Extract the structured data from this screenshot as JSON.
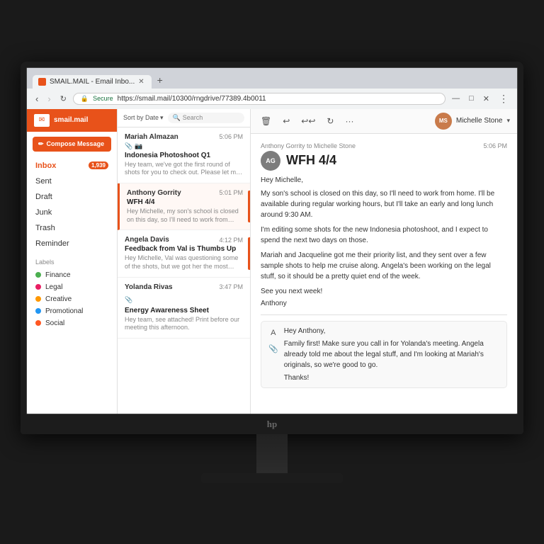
{
  "browser": {
    "tab_title": "SMAIL.MAIL - Email Inbo...",
    "url": "https://smail.mail/10300/rngdrive/77389.4b0011",
    "secure_label": "Secure",
    "window_controls": [
      "—",
      "□",
      "✕"
    ],
    "kebab": "⋮"
  },
  "toolbar_icons": {
    "delete": "🗑",
    "undo": "↩",
    "redo": "↩",
    "refresh": "↻",
    "more": "···"
  },
  "sidebar": {
    "logo_text": "smail.mail",
    "compose_label": "Compose Message",
    "nav_items": [
      {
        "label": "Inbox",
        "badge": "1,939",
        "active": true
      },
      {
        "label": "Sent",
        "badge": null
      },
      {
        "label": "Draft",
        "badge": null
      },
      {
        "label": "Junk",
        "badge": null
      },
      {
        "label": "Trash",
        "badge": null
      },
      {
        "label": "Reminder",
        "badge": null
      }
    ],
    "labels_title": "Labels",
    "labels": [
      {
        "name": "Finance",
        "color": "#4caf50"
      },
      {
        "name": "Legal",
        "color": "#e91e63"
      },
      {
        "name": "Creative",
        "color": "#ff9800"
      },
      {
        "name": "Promotional",
        "color": "#2196f3"
      },
      {
        "name": "Social",
        "color": "#ff5722"
      }
    ]
  },
  "email_list": {
    "sort_label": "Sort by Date",
    "search_placeholder": "Search",
    "emails": [
      {
        "sender": "Mariah Almazan",
        "subject": "Indonesia Photoshoot Q1",
        "time": "5:06 PM",
        "preview": "Hey team, we've got the first round of shots for you to check out. Please let me know your...",
        "icons": [
          "📎",
          "📷"
        ],
        "active": false,
        "priority": false
      },
      {
        "sender": "Anthony Gorrity",
        "subject": "WFH 4/4",
        "time": "5:01 PM",
        "preview": "Hey Michelle, my son's school is closed on this day, so I'll need to work from home. I'll be available...",
        "icons": [],
        "active": true,
        "priority": true
      },
      {
        "sender": "Angela Davis",
        "subject": "Feedback from Val is Thumbs Up",
        "time": "4:12 PM",
        "preview": "Hey Michelle, Val was questioning some of the shots, but we got her the most recent metadata, and she said...",
        "icons": [],
        "active": false,
        "priority": true
      },
      {
        "sender": "Yolanda Rivas",
        "subject": "Energy Awareness Sheet",
        "time": "3:47 PM",
        "preview": "Hey team, see attached! Print before our meeting this afternoon.",
        "icons": [
          "📎"
        ],
        "active": false,
        "priority": false
      }
    ]
  },
  "email_detail": {
    "from": "Anthony Gorrity to Michelle Stone",
    "time": "5:06 PM",
    "subject": "WFH 4/4",
    "avatar_initials": "AG",
    "body_paragraphs": [
      "Hey Michelle,",
      "My son's school is closed on this day, so I'll need to work from home. I'll be available during regular working hours, but I'll take an early and long lunch around 9:30 AM.",
      "I'm editing some shots for the new Indonesia photoshoot, and I expect to spend the next two days on those.",
      "Mariah and Jacqueline got me their priority list, and they sent over a few sample shots to help me cruise along. Angela's been working on the legal stuff, so it should be a pretty quiet end of the week.",
      "See you next week!",
      "Anthony"
    ],
    "reply": {
      "body_paragraphs": [
        "Hey Anthony,",
        "Family first! Make sure you call in for Yolanda's meeting. Angela already told me about the legal stuff, and I'm looking at Mariah's originals, so we're good to go.",
        "Thanks!"
      ],
      "has_attachment_icon": true,
      "has_person_icon": true
    }
  },
  "user": {
    "name": "Michelle Stone",
    "avatar_initials": "MS"
  }
}
